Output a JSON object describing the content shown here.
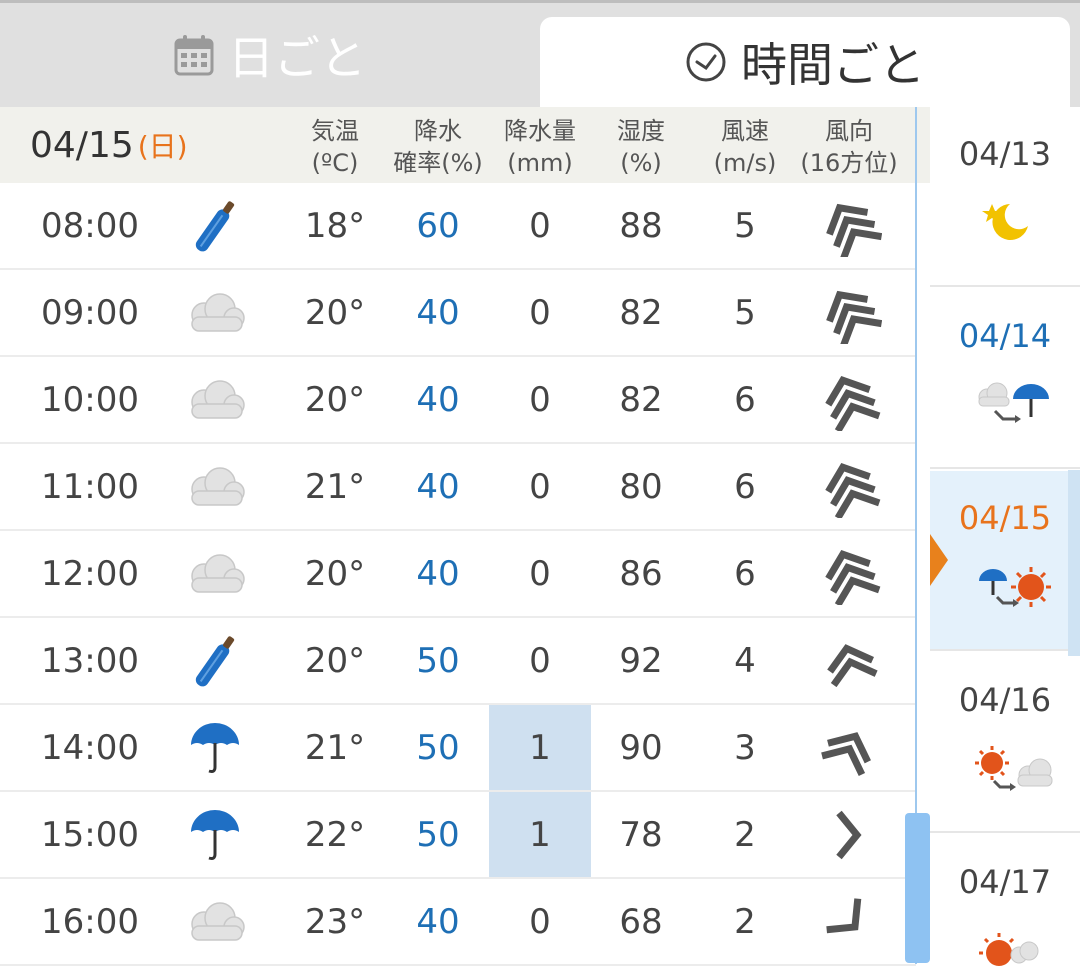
{
  "tabs": {
    "daily_label": "日ごと",
    "hourly_label": "時間ごと"
  },
  "header": {
    "date": "04/15",
    "weekday": "(日)",
    "columns": [
      {
        "line1": "気温",
        "line2": "(ºC)"
      },
      {
        "line1": "降水",
        "line2": "確率(%)"
      },
      {
        "line1": "降水量",
        "line2": "(mm)"
      },
      {
        "line1": "湿度",
        "line2": "(%)"
      },
      {
        "line1": "風速",
        "line2": "(m/s)"
      },
      {
        "line1": "風向",
        "line2": "(16方位)"
      }
    ]
  },
  "rows": [
    {
      "time": "08:00",
      "icon": "closed-umbrella",
      "temp": "18°",
      "prob": "60",
      "amount": "0",
      "humidity": "88",
      "wind": "5",
      "wind_dir_icon": "wind-direction-arrow"
    },
    {
      "time": "09:00",
      "icon": "cloud",
      "temp": "20°",
      "prob": "40",
      "amount": "0",
      "humidity": "82",
      "wind": "5",
      "wind_dir_icon": "wind-direction-arrow"
    },
    {
      "time": "10:00",
      "icon": "cloud",
      "temp": "20°",
      "prob": "40",
      "amount": "0",
      "humidity": "82",
      "wind": "6",
      "wind_dir_icon": "wind-direction-arrow"
    },
    {
      "time": "11:00",
      "icon": "cloud",
      "temp": "21°",
      "prob": "40",
      "amount": "0",
      "humidity": "80",
      "wind": "6",
      "wind_dir_icon": "wind-direction-arrow"
    },
    {
      "time": "12:00",
      "icon": "cloud",
      "temp": "20°",
      "prob": "40",
      "amount": "0",
      "humidity": "86",
      "wind": "6",
      "wind_dir_icon": "wind-direction-arrow"
    },
    {
      "time": "13:00",
      "icon": "closed-umbrella",
      "temp": "20°",
      "prob": "50",
      "amount": "0",
      "humidity": "92",
      "wind": "4",
      "wind_dir_icon": "wind-direction-arrow"
    },
    {
      "time": "14:00",
      "icon": "umbrella",
      "temp": "21°",
      "prob": "50",
      "amount": "1",
      "humidity": "90",
      "wind": "3",
      "wind_dir_icon": "wind-direction-arrow"
    },
    {
      "time": "15:00",
      "icon": "umbrella",
      "temp": "22°",
      "prob": "50",
      "amount": "1",
      "humidity": "78",
      "wind": "2",
      "wind_dir_icon": "wind-direction-arrow"
    },
    {
      "time": "16:00",
      "icon": "cloud",
      "temp": "23°",
      "prob": "40",
      "amount": "0",
      "humidity": "68",
      "wind": "2",
      "wind_dir_icon": "wind-direction-arrow"
    }
  ],
  "days": [
    {
      "date": "04/13",
      "color": "#444444",
      "icon": "moon-star"
    },
    {
      "date": "04/14",
      "color": "#1e6fb5",
      "icon": "cloud-then-rain"
    },
    {
      "date": "04/15",
      "color": "#e8731c",
      "icon": "rain-then-sun"
    },
    {
      "date": "04/16",
      "color": "#444444",
      "icon": "sun-then-cloud"
    },
    {
      "date": "04/17",
      "color": "#444444",
      "icon": "sun-cloud"
    }
  ],
  "colors": {
    "accent_blue": "#1e6fb5",
    "accent_orange": "#e8731c",
    "highlight_cell": "#cfe0f0",
    "selected_day": "#e4f1fb"
  }
}
